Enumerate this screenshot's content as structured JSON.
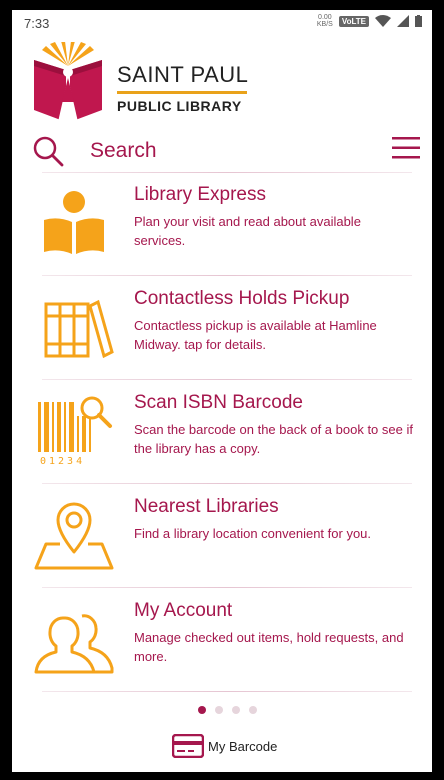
{
  "status_bar": {
    "time": "7:33",
    "net_speed": "0.00",
    "net_unit": "KB/S",
    "volte": "VoLTE"
  },
  "logo": {
    "line1": "SAINT PAUL",
    "line2": "PUBLIC LIBRARY"
  },
  "search": {
    "label": "Search"
  },
  "items": [
    {
      "title": "Library Express",
      "description": "Plan your visit and read about available services.",
      "icon": "open-book-reader-icon"
    },
    {
      "title": "Contactless Holds Pickup",
      "description": "Contactless pickup is available at Hamline Midway. tap for details.",
      "icon": "books-icon"
    },
    {
      "title": "Scan ISBN Barcode",
      "description": "Scan the barcode on the back of a book to see if the library has a copy.",
      "icon": "barcode-scan-icon",
      "barcode_digits": "01234"
    },
    {
      "title": "Nearest Libraries",
      "description": "Find a library location convenient for you.",
      "icon": "map-pin-icon"
    },
    {
      "title": "My Account",
      "description": "Manage checked out items, hold requests, and more.",
      "icon": "users-icon"
    }
  ],
  "pager": {
    "count": 4,
    "active_index": 0
  },
  "barcode_button": {
    "label": "My Barcode",
    "icon": "card-icon"
  },
  "colors": {
    "accent": "#a5174d",
    "icon_orange": "#f5a31a",
    "logo_red": "#c0174e"
  }
}
